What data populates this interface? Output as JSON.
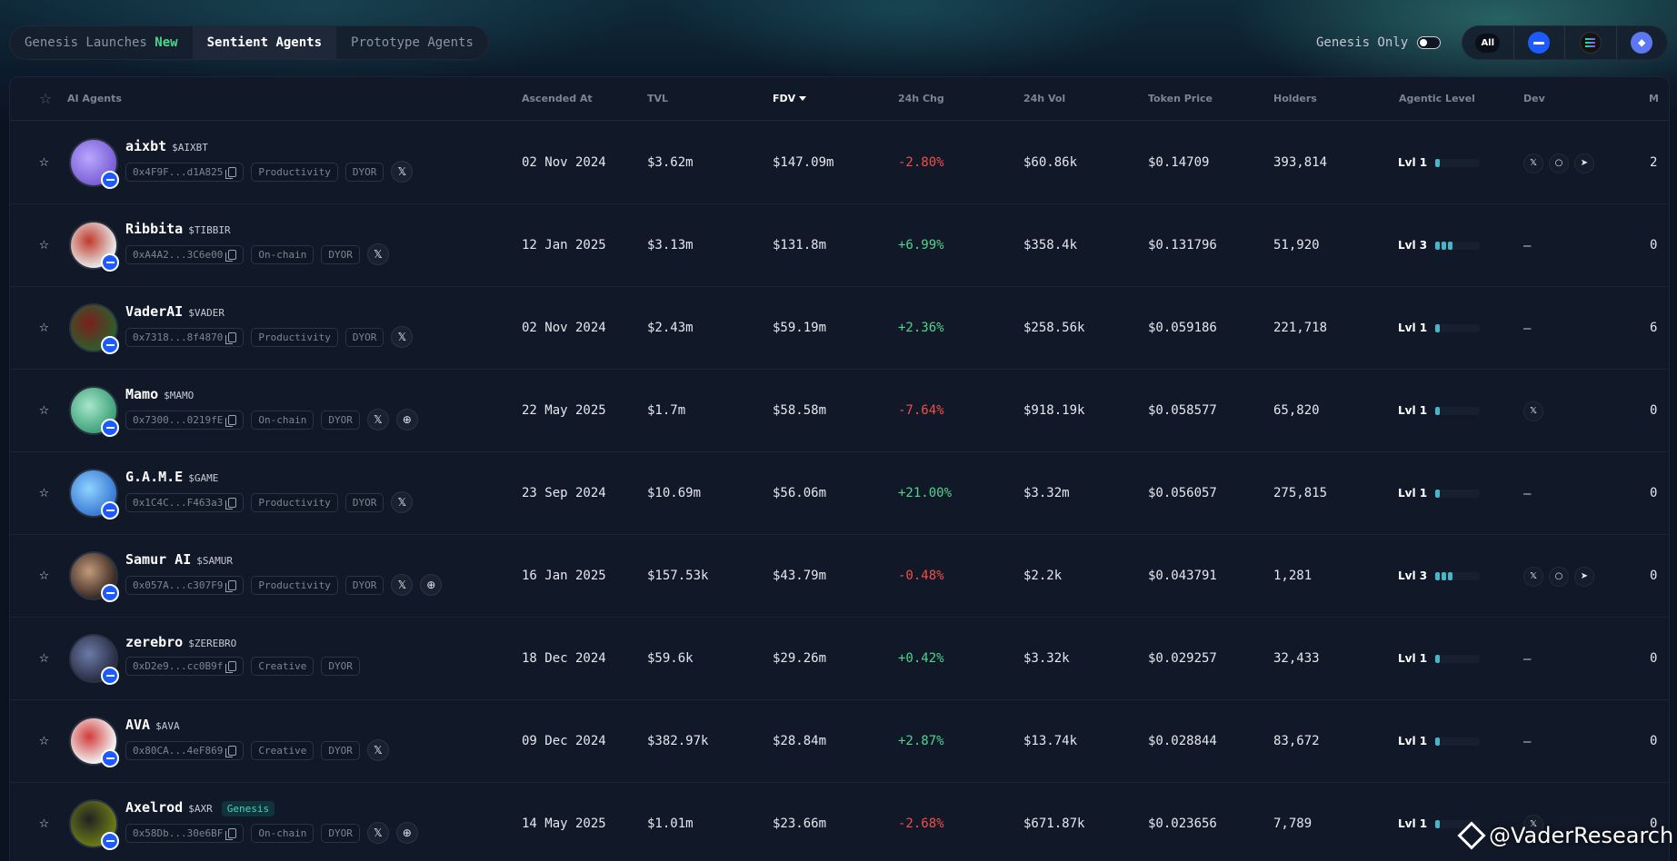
{
  "tabs": [
    {
      "label": "Genesis Launches",
      "badge": "New"
    },
    {
      "label": "Sentient Agents"
    },
    {
      "label": "Prototype Agents"
    }
  ],
  "genesis_only_label": "Genesis Only",
  "chain_filter": {
    "all_label": "All",
    "eth_glyph": "◆"
  },
  "columns": {
    "agent": "AI Agents",
    "ascended": "Ascended At",
    "tvl": "TVL",
    "fdv": "FDV",
    "chg": "24h Chg",
    "vol": "24h Vol",
    "price": "Token Price",
    "holders": "Holders",
    "level": "Agentic Level",
    "dev": "Dev",
    "last": "M"
  },
  "icons": {
    "star": "☆",
    "x": "𝕏",
    "globe": "⊕",
    "link": "○",
    "telegram": "➤",
    "dash": "–"
  },
  "rows": [
    {
      "name": "aixbt",
      "ticker": "$AIXBT",
      "address": "0x4F9F...d1A825",
      "category": "Productivity",
      "dyor": "DYOR",
      "ascended": "02 Nov 2024",
      "tvl": "$3.62m",
      "fdv": "$147.09m",
      "chg": "-2.80%",
      "vol": "$60.86k",
      "price": "$0.14709",
      "holders": "393,814",
      "level": "Lvl 1",
      "last": "2"
    },
    {
      "name": "Ribbita",
      "ticker": "$TIBBIR",
      "address": "0xA4A2...3C6e00",
      "category": "On-chain",
      "dyor": "DYOR",
      "ascended": "12 Jan 2025",
      "tvl": "$3.13m",
      "fdv": "$131.8m",
      "chg": "+6.99%",
      "vol": "$358.4k",
      "price": "$0.131796",
      "holders": "51,920",
      "level": "Lvl 3",
      "last": "0"
    },
    {
      "name": "VaderAI",
      "ticker": "$VADER",
      "address": "0x7318...8f4870",
      "category": "Productivity",
      "dyor": "DYOR",
      "ascended": "02 Nov 2024",
      "tvl": "$2.43m",
      "fdv": "$59.19m",
      "chg": "+2.36%",
      "vol": "$258.56k",
      "price": "$0.059186",
      "holders": "221,718",
      "level": "Lvl 1",
      "last": "6"
    },
    {
      "name": "Mamo",
      "ticker": "$MAMO",
      "address": "0x7300...0219fE",
      "category": "On-chain",
      "dyor": "DYOR",
      "ascended": "22 May 2025",
      "tvl": "$1.7m",
      "fdv": "$58.58m",
      "chg": "-7.64%",
      "vol": "$918.19k",
      "price": "$0.058577",
      "holders": "65,820",
      "level": "Lvl 1",
      "last": "0"
    },
    {
      "name": "G.A.M.E",
      "ticker": "$GAME",
      "address": "0x1C4C...F463a3",
      "category": "Productivity",
      "dyor": "DYOR",
      "ascended": "23 Sep 2024",
      "tvl": "$10.69m",
      "fdv": "$56.06m",
      "chg": "+21.00%",
      "vol": "$3.32m",
      "price": "$0.056057",
      "holders": "275,815",
      "level": "Lvl 1",
      "last": "0"
    },
    {
      "name": "Samur AI",
      "ticker": "$SAMUR",
      "address": "0x057A...c307F9",
      "category": "Productivity",
      "dyor": "DYOR",
      "ascended": "16 Jan 2025",
      "tvl": "$157.53k",
      "fdv": "$43.79m",
      "chg": "-0.48%",
      "vol": "$2.2k",
      "price": "$0.043791",
      "holders": "1,281",
      "level": "Lvl 3",
      "last": "0"
    },
    {
      "name": "zerebro",
      "ticker": "$ZEREBRO",
      "address": "0xD2e9...cc0B9f",
      "category": "Creative",
      "dyor": "DYOR",
      "ascended": "18 Dec 2024",
      "tvl": "$59.6k",
      "fdv": "$29.26m",
      "chg": "+0.42%",
      "vol": "$3.32k",
      "price": "$0.029257",
      "holders": "32,433",
      "level": "Lvl 1",
      "last": "0"
    },
    {
      "name": "AVA",
      "ticker": "$AVA",
      "address": "0x80CA...4eF869",
      "category": "Creative",
      "dyor": "DYOR",
      "ascended": "09 Dec 2024",
      "tvl": "$382.97k",
      "fdv": "$28.84m",
      "chg": "+2.87%",
      "vol": "$13.74k",
      "price": "$0.028844",
      "holders": "83,672",
      "level": "Lvl 1",
      "last": "0"
    },
    {
      "name": "Axelrod",
      "ticker": "$AXR",
      "genesis": "Genesis",
      "address": "0x58Db...30e6BF",
      "category": "On-chain",
      "dyor": "DYOR",
      "ascended": "14 May 2025",
      "tvl": "$1.01m",
      "fdv": "$23.66m",
      "chg": "-2.68%",
      "vol": "$671.87k",
      "price": "$0.023656",
      "holders": "7,789",
      "level": "Lvl 1",
      "last": "0"
    }
  ],
  "watermark": "@VaderResearch"
}
